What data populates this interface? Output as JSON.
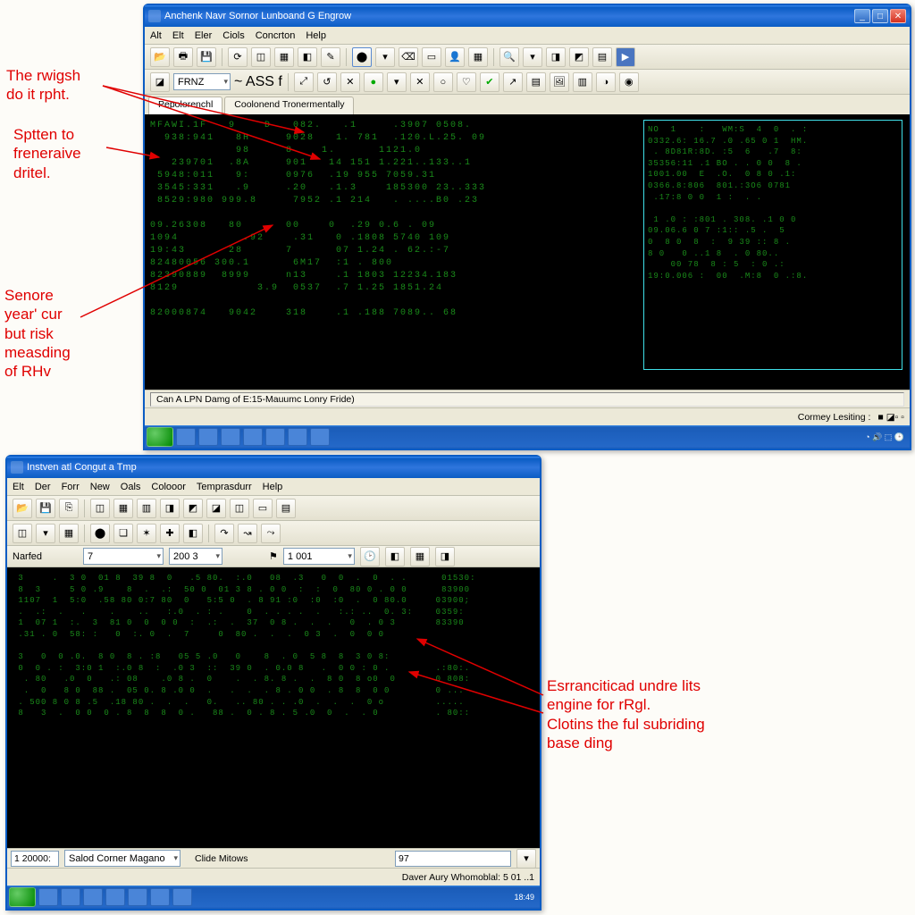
{
  "annotations": {
    "a1": "The rwigsh\ndo it rpht.",
    "a2": "Sptten to\nfreneraive\ndritel.",
    "a3": "Senore\nyear' cur\nbut risk\nmeasding\nof RHv",
    "a4": "Esrranciticad undre lits\nengine for rRgl.\nClotins the ful subriding\nbase ding"
  },
  "window1": {
    "title": "Anchenk Navr Sornor Lunboand G Engrow",
    "menu": [
      "Alt",
      "Elt",
      "Eler",
      "Ciols",
      "Concrton",
      "Help"
    ],
    "combo1": "FRNZ",
    "combo1_after": "~ ASS f",
    "tabs": [
      "Pepolorenchl",
      "Coolonend Tronermentally"
    ],
    "status_left": "Can A LPN Damg of E:15-Mauumc Lonry Fride)",
    "status_right": "Cormey Lesiting :",
    "grid_rows": [
      "MFAWI.1F   9    D   082.   .1     .3907 0508.  ",
      "  938:941   8H     9028   1. 781  .120.L.25. 09",
      "            98     8    1.      1121.0",
      "   239701  .8A     901   14 151 1.221..133..1",
      " 5948:011   9:     0976  .19 955 7059.31       ",
      " 3545:331   .9     .20   .1.3    185300 23..333",
      " 8529:980 999.8     7952 .1 214   . ....B0 .23 ",
      "                 ",
      "09.26308   80      00    0  .29 0.6 . 09",
      "1094         .92    .31   0 .1808 5740 109     ",
      "19:43      28      7      07 1.24 . 62.:-7     ",
      "82480056 300.1      6M17  :1 . 800             ",
      "82390889  8999     n13    .1 1803 12234.183    ",
      "8129           3.9  0537  .7 1.25 1851.24      ",
      "    ",
      "82000874   9042    318    .1 .188 7089.. 68    "
    ],
    "right_panel_rows": [
      "NO  1    :   WM:S  4  0  . : ",
      "0332.6: 16.7 .0 .65 0 1  HM. ",
      " . 8D81R:8D. :5  6   .7  8:",
      "35356:11 .1 BO . . 0 0  8 . ",
      "1001.00  E  .O.  0 8 0 .1:",
      "0366.8:806  801.:3O6 0781",
      " .17:8 0 0  1 :  . .",
      "",
      " 1 .0 : :801 . 308. .1 0 0 ",
      "09.06.6 0 7 :1:: .5 .  5  ",
      "0  8 0  8  :  9 39 :: 8 .",
      "8 0   0 ..1 8  . 0 80..",
      "    00 78  8 : 5  : 0 .:",
      "19:0.006 :  00  .M:8  0 .:8."
    ]
  },
  "window2": {
    "title": "Instven atl Congut a Tmp",
    "menu": [
      "Elt",
      "Der",
      "Forr",
      "New",
      "Oals",
      "Colooor",
      "Temprasdurr",
      "Help"
    ],
    "label_narfed": "Narfed",
    "combo_a": "7",
    "combo_b": "200 3",
    "combo_c": "1 001",
    "bottom_left_val": "1 20000:",
    "bottom_sel": "Salod Corner Magano",
    "bottom_label2": "Clide Mitows",
    "bottom_field": "97",
    "status_text": "Daver Aury Whomoblal: 5    01   ..1",
    "grid_rows": [
      " 3     .  3 0  01 8  39 8  0   .5 80.  :.0   08  .3   0  0  .  0  . .      01530:",
      " 8  3     5 0 .9    8  .  .:  50 0  01 3 8 . 0 0  :  :  0  80 0 . 0 0      83900 ",
      " 1107  1  5:0  .58 80 0:7 80  0   5:5 0  . 8 91 :0  :0  :0  .  0 80.0     03900;",
      " .  .:  .   .    .    ..   :.0  . : .    0  . . . .  .   :.: ..  0. 3:    0359: ",
      " 1  07 1  :.  3  81 0  0  0 0  :  .:  .  37  0 8 .  .  .   0  . 0 3       83390 ",
      " .31 . 0  58: :   0  :. 0  .  7     0  80 .  .  .  0 3  .  0  0 0         ",
      "",
      " 3   0  0 .0.  8 0  8 . :8   05 5 .0   0    8  . 0  5 8  8  3 0 8:",
      " 0  0 . :  3:0 1  :.0 8  :  .0 3  ::  39 0  . 0.0 8   .  0 0 : 0 .        .:80:.",
      "  . 80   .0  0   .: 08    .0 8 .  0    .  . 8. 8 .  .  8 0  8 o0  0       0 808:",
      "  .  0   8 0  88 .  05 0. 8 .0 0  .   .  .  . 8 . 0 0  . 8  8  0 0        0 ...",
      " . 500 8 0 8 .5  .18 80 .  .  .   0.   .. 80 . . .0  .  .  .  0 o         .....",
      " 8   3  .  0 0  0 . 8  8  8  0 .   88 .  0 . 8 . 5 .0  0  .  . 0          . 80::"
    ]
  }
}
